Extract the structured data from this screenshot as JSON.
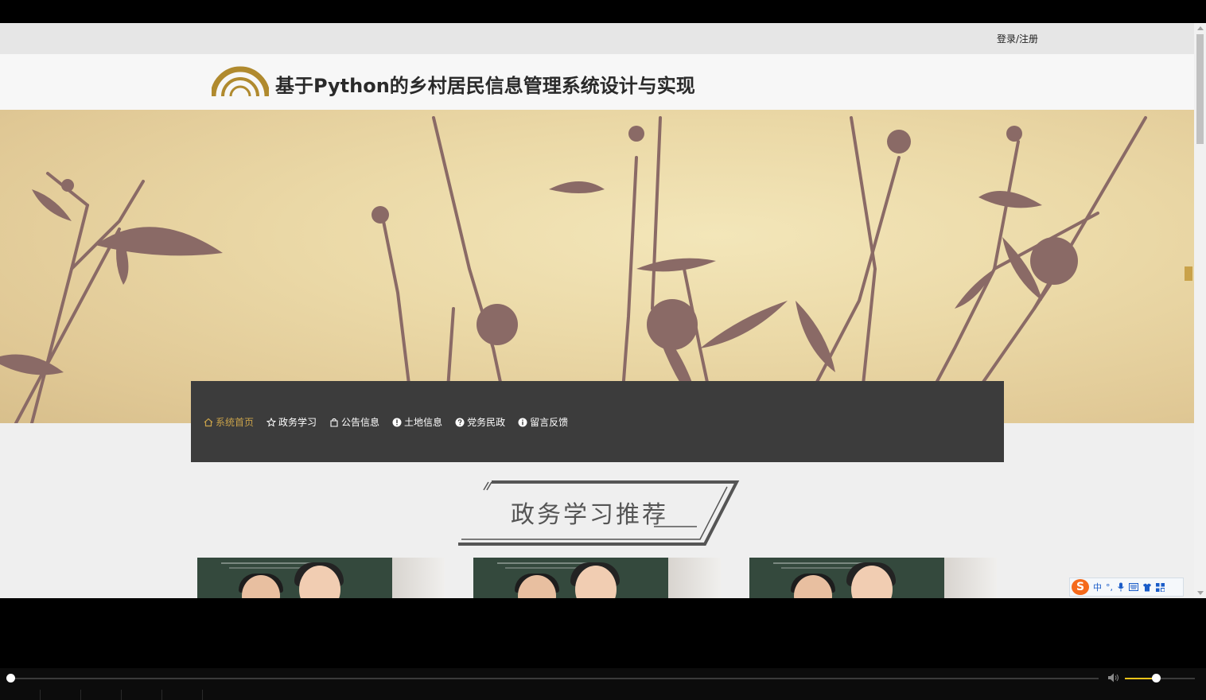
{
  "topbar": {
    "login_label": "登录/注册"
  },
  "header": {
    "title": "基于Python的乡村居民信息管理系统设计与实现"
  },
  "nav": {
    "items": [
      {
        "label": "系统首页",
        "icon": "home-icon",
        "active": true
      },
      {
        "label": "政务学习",
        "icon": "star-icon",
        "active": false
      },
      {
        "label": "公告信息",
        "icon": "bag-icon",
        "active": false
      },
      {
        "label": "土地信息",
        "icon": "info-circle-icon",
        "active": false
      },
      {
        "label": "党务民政",
        "icon": "question-circle-icon",
        "active": false
      },
      {
        "label": "留言反馈",
        "icon": "info-circle-icon",
        "active": false
      }
    ]
  },
  "section": {
    "title": "政务学习推荐"
  },
  "cards": [
    {
      "image": "teacher-classroom-photo"
    },
    {
      "image": "teacher-classroom-photo"
    },
    {
      "image": "teacher-classroom-photo"
    }
  ],
  "ime": {
    "logo": "S",
    "items": [
      "中",
      "°,",
      "mic-icon",
      "keyboard-icon",
      "shirt-icon",
      "grid-icon"
    ]
  },
  "player": {
    "seek_progress": 0.0,
    "volume": 0.45
  },
  "colors": {
    "accent": "#c9a24a",
    "nav_bg": "#3c3c3c",
    "volume_fill": "#f0c419"
  }
}
